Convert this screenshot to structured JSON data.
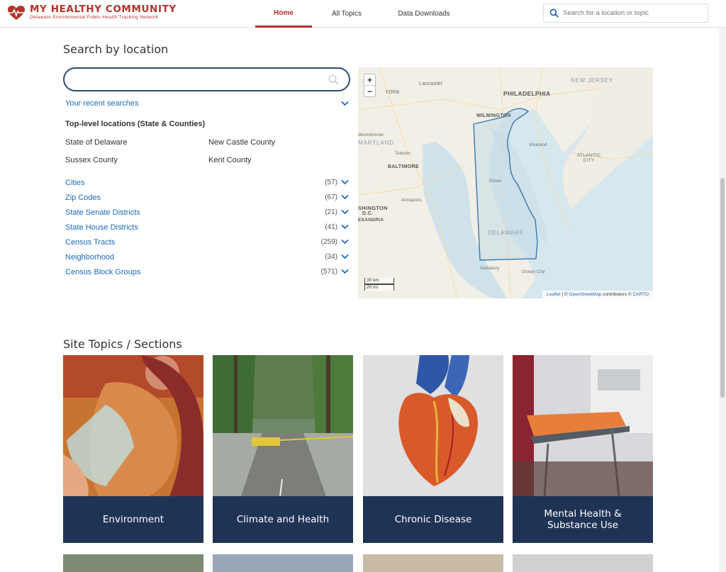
{
  "header": {
    "logo_title": "MY HEALTHY COMMUNITY",
    "logo_subtitle": "Delaware Environmental Public Health Tracking Network",
    "brand_color": "#b2332a",
    "nav": [
      {
        "label": "Home",
        "active": true
      },
      {
        "label": "All Topics",
        "active": false
      },
      {
        "label": "Data Downloads",
        "active": false
      }
    ],
    "search_placeholder": "Search for a location or topic"
  },
  "location": {
    "title": "Search by location",
    "search_value": "",
    "recent_searches_label": "Your recent searches",
    "toplevel_title": "Top-level locations (State & Counties)",
    "toplevel": [
      "State of Delaware",
      "New Castle County",
      "Sussex County",
      "Kent County"
    ],
    "categories": [
      {
        "label": "Cities",
        "count": "(57)"
      },
      {
        "label": "Zip Codes",
        "count": "(67)"
      },
      {
        "label": "State Senate Districts",
        "count": "(21)"
      },
      {
        "label": "State House Districts",
        "count": "(41)"
      },
      {
        "label": "Census Tracts",
        "count": "(259)"
      },
      {
        "label": "Neighborhood",
        "count": "(34)"
      },
      {
        "label": "Census Block Groups",
        "count": "(571)"
      }
    ],
    "link_color": "#1a6bb8"
  },
  "map": {
    "zoom_in": "+",
    "zoom_out": "−",
    "labels": {
      "york": "YORK",
      "lancaster": "Lancaster",
      "philadelphia": "PHILADELPHIA",
      "new_jersey": "NEW JERSEY",
      "wilmington": "WILMINGTON",
      "westminster": "Westminster",
      "maryland": "MARYLAND",
      "vineland": "Vineland",
      "towson": "Towson",
      "baltimore": "BALTIMORE",
      "atlantic_city": "ATLANTIC\nCITY",
      "dover": "Dover",
      "annapolis": "Annapolis",
      "washington": "SHINGTON",
      "dc": "D.C.",
      "alexandria": "EXANDRIA",
      "delaware": "DELAWARE",
      "salisbury": "Salisbury",
      "ocean_city": "Ocean City"
    },
    "scale_km": "30 km",
    "scale_mi": "20 mi",
    "attribution_leaflet": "Leaflet",
    "attribution_sep1": " | © ",
    "attribution_osm": "OpenStreetMap",
    "attribution_mid": " contributors © ",
    "attribution_carto": "CARTO"
  },
  "topics": {
    "title": "Site Topics / Sections",
    "cards": [
      {
        "label": "Environment"
      },
      {
        "label": "Climate and Health"
      },
      {
        "label": "Chronic Disease"
      },
      {
        "label": "Mental Health & Substance Use"
      }
    ],
    "card_bar_color": "#1f3455"
  }
}
